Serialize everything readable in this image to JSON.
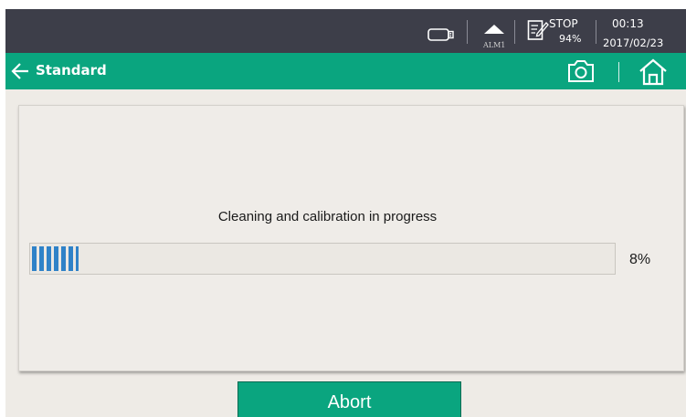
{
  "status_bar": {
    "usb_icon": "usb-drive-icon",
    "alarm_icon": "triangle-up-icon",
    "alarm_label": "ALM1",
    "note_icon": "note-edit-icon",
    "run_state": "STOP",
    "battery_percent": "94%",
    "time": "00:13",
    "date": "2017/02/23"
  },
  "title_bar": {
    "back_icon": "arrow-left-icon",
    "title": "Standard",
    "camera_icon": "camera-icon",
    "home_icon": "home-icon"
  },
  "progress": {
    "label": "Cleaning and calibration in progress",
    "value": 0.08,
    "value_text": "8%"
  },
  "abort_button": {
    "label": "Abort"
  },
  "colors": {
    "status_bar_bg": "#3d3e49",
    "accent_green": "#0aa57f",
    "progress_blue": "#2f82c8",
    "panel_bg": "#efece8"
  }
}
